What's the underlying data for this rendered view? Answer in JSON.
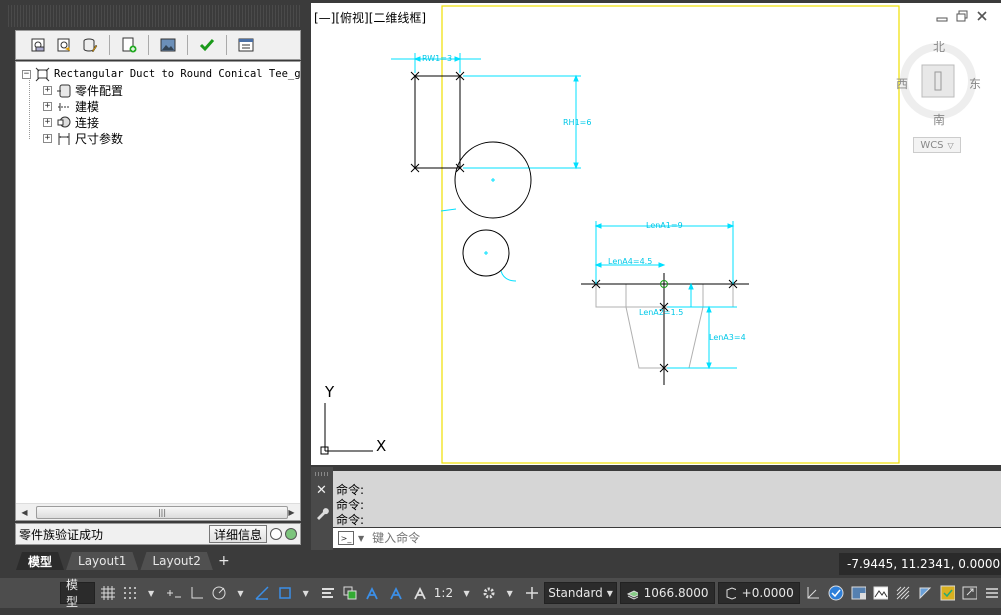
{
  "tree": {
    "root": "Rectangular Duct to Round Conical Tee_gb",
    "items": [
      {
        "label": "零件配置",
        "icon": "part-config-icon"
      },
      {
        "label": "建模",
        "icon": "modeling-icon"
      },
      {
        "label": "连接",
        "icon": "connection-icon"
      },
      {
        "label": "尺寸参数",
        "icon": "dimension-params-icon"
      }
    ]
  },
  "palette_status": {
    "message": "零件族验证成功",
    "detail_button": "详细信息",
    "status_color": "#7cc47c"
  },
  "viewport": {
    "label": "[—][俯视][二维线框]",
    "compass": {
      "north": "北",
      "south": "南",
      "east": "东",
      "west": "西"
    },
    "wcs": "WCS",
    "axis_x": "X",
    "axis_y": "Y"
  },
  "drawing": {
    "dims": {
      "rw1": "RW1=3",
      "rh1": "RH1=6",
      "lena1": "LenA1=9",
      "lena4": "LenA4=4.5",
      "lena2": "LenA2=1.5",
      "lena3": "LenA3=4"
    },
    "colors": {
      "frame": "#f0e000",
      "dimension": "#00e0ff",
      "geometry": "#000000",
      "profile": "#b0b0b0"
    }
  },
  "command": {
    "history": [
      "命令:",
      "命令:",
      "命令:"
    ],
    "placeholder": "键入命令"
  },
  "tabs": [
    "模型",
    "Layout1",
    "Layout2"
  ],
  "tab_add": "+",
  "coordinates": "-7.9445, 11.2341, 0.0000",
  "statusbar": {
    "model": "模型",
    "scale": "1:2",
    "style": "Standard",
    "elevation": "1066.8000",
    "offset": "+0.0000"
  }
}
